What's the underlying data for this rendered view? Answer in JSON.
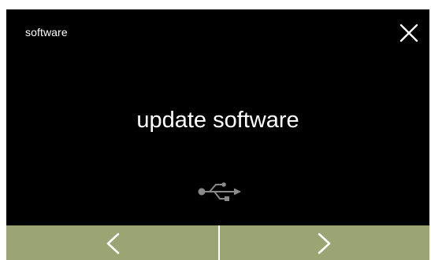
{
  "screen": {
    "title": "software",
    "headline": "update software"
  },
  "icons": {
    "close": "close-icon",
    "usb": "usb-icon",
    "previous": "chevron-left-icon",
    "next": "chevron-right-icon"
  },
  "colors": {
    "background": "#000000",
    "text": "#ffffff",
    "nav_bar": "#9ba473",
    "usb_icon": "#8a8a8a"
  }
}
